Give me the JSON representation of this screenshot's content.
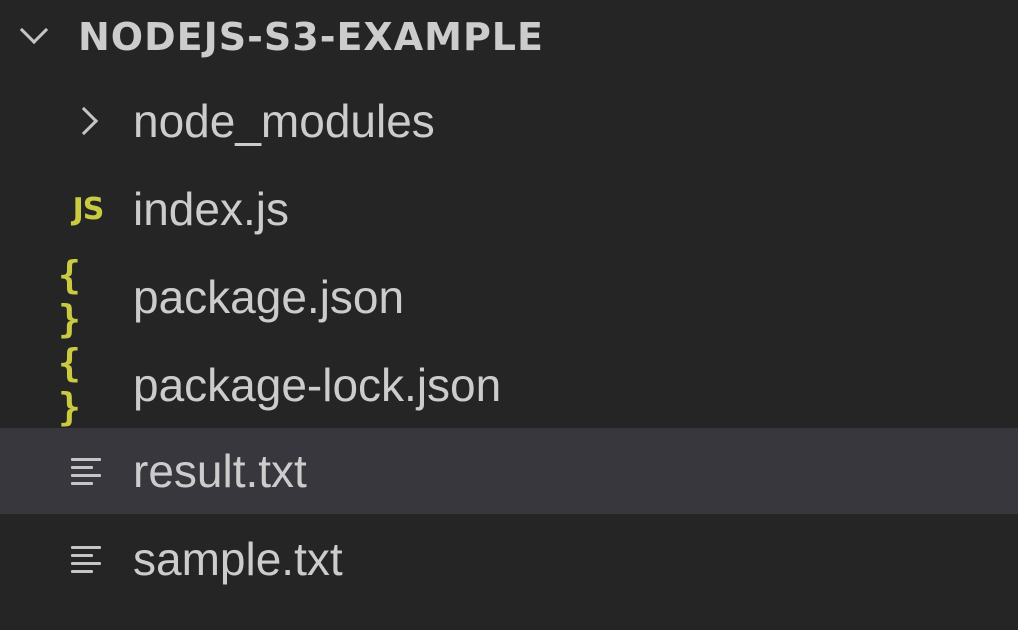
{
  "explorer": {
    "folder_title": "NODEJS-S3-EXAMPLE",
    "items": [
      {
        "label": "node_modules",
        "kind": "folder",
        "icon": "chevron-right-icon"
      },
      {
        "label": "index.js",
        "kind": "file",
        "icon": "js-file-icon",
        "icon_glyph": "JS",
        "icon_color": "#cbcb41"
      },
      {
        "label": "package.json",
        "kind": "file",
        "icon": "json-file-icon",
        "icon_glyph": "{ }",
        "icon_color": "#cbcb41"
      },
      {
        "label": "package-lock.json",
        "kind": "file",
        "icon": "json-file-icon",
        "icon_glyph": "{ }",
        "icon_color": "#cbcb41"
      },
      {
        "label": "result.txt",
        "kind": "file",
        "icon": "text-file-icon",
        "selected": true
      },
      {
        "label": "sample.txt",
        "kind": "file",
        "icon": "text-file-icon"
      }
    ]
  },
  "colors": {
    "background": "#252526",
    "selected_row": "#37373d",
    "text": "#cccccc",
    "icon_yellow": "#cbcb41"
  }
}
